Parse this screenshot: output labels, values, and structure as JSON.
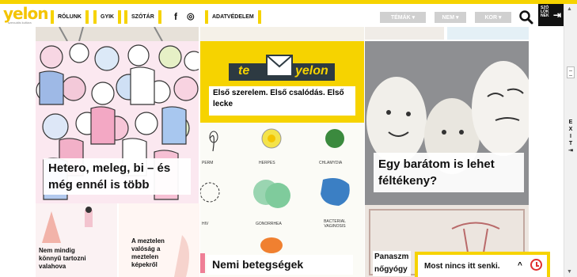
{
  "logo": {
    "text": "yelon",
    "sub": "szexuális kultúra"
  },
  "nav": {
    "items": [
      {
        "label": "RÓLUNK"
      },
      {
        "label": "GYIK"
      },
      {
        "label": "SZÓTÁR"
      },
      {
        "label": "ADATVÉDELEM"
      }
    ],
    "social": {
      "facebook": "f",
      "instagram": "◎"
    },
    "dropdowns": [
      {
        "label": "TÉMÁK ▾"
      },
      {
        "label": "NEM ▾"
      },
      {
        "label": "KOR ▾"
      }
    ],
    "szolok": {
      "lines": [
        "SZÓ",
        "LOK",
        "NEK"
      ],
      "arrow": "⇥"
    }
  },
  "sidebar": {
    "exit_letters": [
      "E",
      "X",
      "I",
      "T"
    ],
    "exit_icon": "⇥",
    "up_arrow": "▲",
    "down_arrow": "▼"
  },
  "cards": {
    "hetero": {
      "title": "Hetero, meleg, bi – és még ennél is több"
    },
    "teyelon": {
      "brand_left": "te",
      "brand_right": "yelon",
      "title": "Első szerelem. Első csalódás. Első lecke"
    },
    "barat": {
      "title": "Egy barátom is lehet féltékeny?"
    },
    "nemmindig": {
      "title": "Nem mindig könnyű tartozni valahova"
    },
    "meztelen": {
      "title": "A meztelen valóság a meztelen képekről"
    },
    "nemi": {
      "title": "Nemi betegségek",
      "labels": [
        "PERM",
        "HERPES",
        "CHLAMYDIA",
        "HIV",
        "GONORRHEA",
        "BACTERIAL VAGINOSIS"
      ]
    },
    "panasz": {
      "title": "Panaszm nőgyógy"
    }
  },
  "chat": {
    "text": "Most nincs itt senki.",
    "up": "^"
  }
}
